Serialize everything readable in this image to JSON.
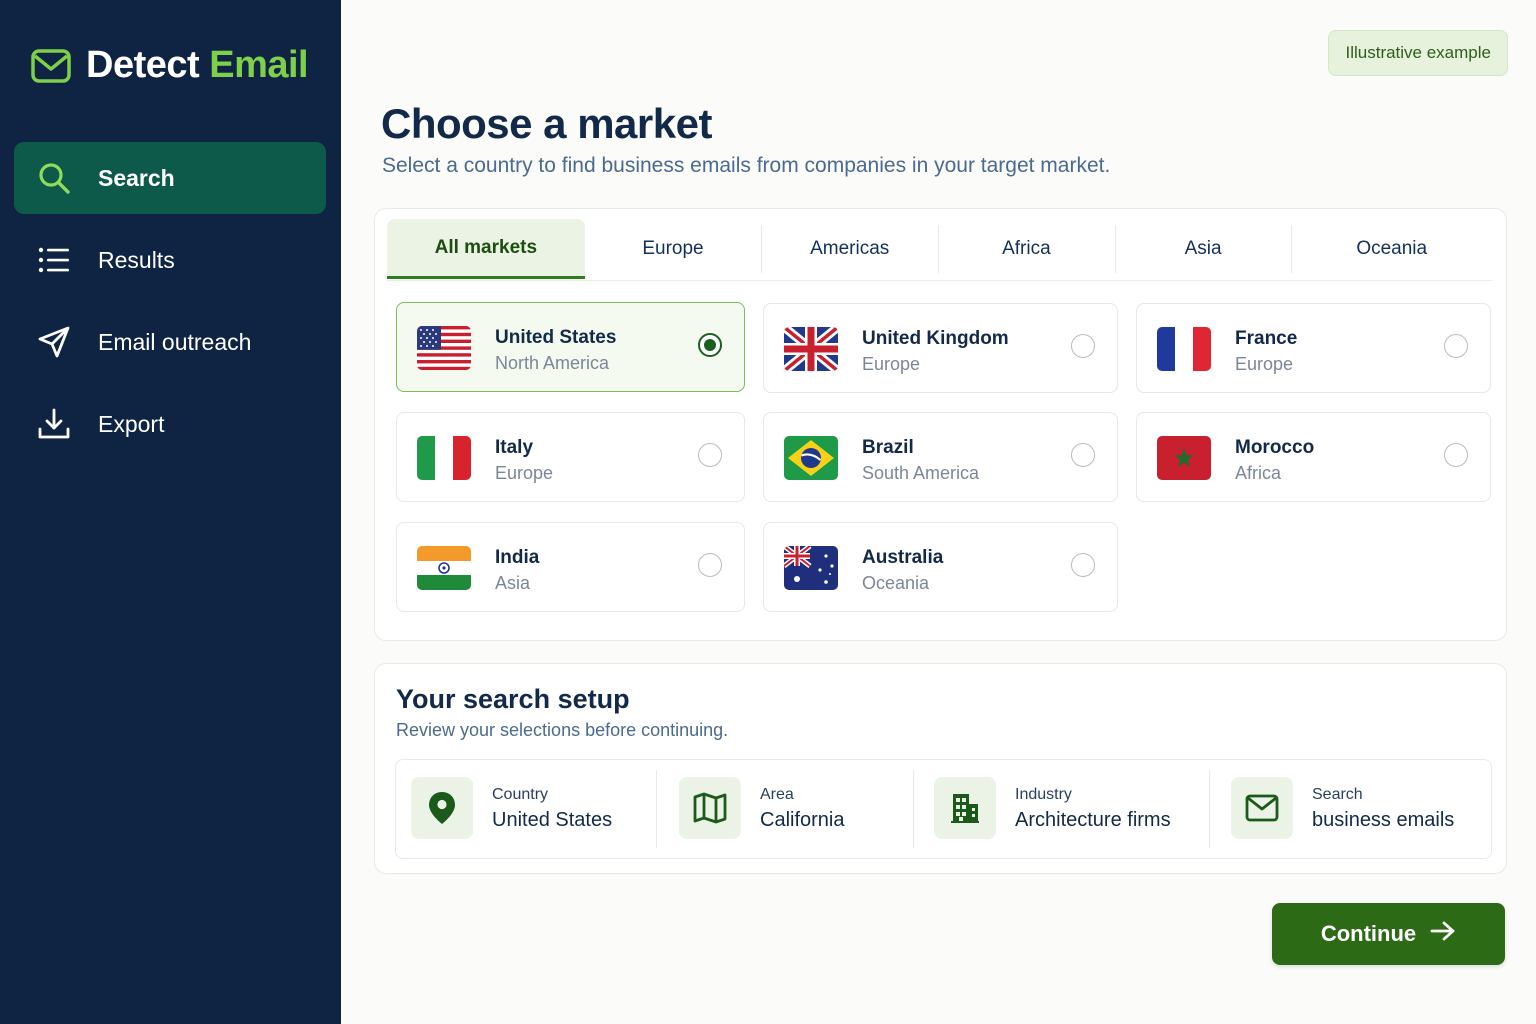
{
  "brand": {
    "name_part1": "Detect",
    "name_part2": "Email",
    "icon": "mail-icon"
  },
  "sidebar": {
    "items": [
      {
        "label": "Search",
        "icon": "search-icon",
        "active": true
      },
      {
        "label": "Results",
        "icon": "list-icon",
        "active": false
      },
      {
        "label": "Email outreach",
        "icon": "send-icon",
        "active": false
      },
      {
        "label": "Export",
        "icon": "download-icon",
        "active": false
      }
    ]
  },
  "badge": "Illustrative example",
  "header": {
    "title": "Choose a market",
    "subtitle": "Select a country to find business emails from companies in your target market."
  },
  "tabs": [
    {
      "label": "All markets",
      "active": true
    },
    {
      "label": "Europe",
      "active": false
    },
    {
      "label": "Americas",
      "active": false
    },
    {
      "label": "Africa",
      "active": false
    },
    {
      "label": "Asia",
      "active": false
    },
    {
      "label": "Oceania",
      "active": false
    }
  ],
  "countries": [
    {
      "name": "United States",
      "region": "North America",
      "selected": true,
      "flag": "us-flag-icon"
    },
    {
      "name": "United Kingdom",
      "region": "Europe",
      "selected": false,
      "flag": "uk-flag-icon"
    },
    {
      "name": "France",
      "region": "Europe",
      "selected": false,
      "flag": "france-flag-icon"
    },
    {
      "name": "Italy",
      "region": "Europe",
      "selected": false,
      "flag": "italy-flag-icon"
    },
    {
      "name": "Brazil",
      "region": "South America",
      "selected": false,
      "flag": "brazil-flag-icon"
    },
    {
      "name": "Morocco",
      "region": "Africa",
      "selected": false,
      "flag": "morocco-flag-icon"
    },
    {
      "name": "India",
      "region": "Asia",
      "selected": false,
      "flag": "india-flag-icon"
    },
    {
      "name": "Australia",
      "region": "Oceania",
      "selected": false,
      "flag": "australia-flag-icon"
    }
  ],
  "setup": {
    "title": "Your search setup",
    "subtitle": "Review your selections before continuing.",
    "items": [
      {
        "label": "Country",
        "value": "United States",
        "icon": "map-pin-icon"
      },
      {
        "label": "Area",
        "value": "California",
        "icon": "map-icon"
      },
      {
        "label": "Industry",
        "value": "Architecture firms",
        "icon": "building-icon"
      },
      {
        "label": "Search",
        "value": "business emails",
        "icon": "mail-icon"
      }
    ]
  },
  "continue_label": "Continue",
  "colors": {
    "sidebar": "#0e2442",
    "accent": "#7ed04b",
    "primary": "#2c6a16",
    "active_nav": "#0d5a4a"
  }
}
